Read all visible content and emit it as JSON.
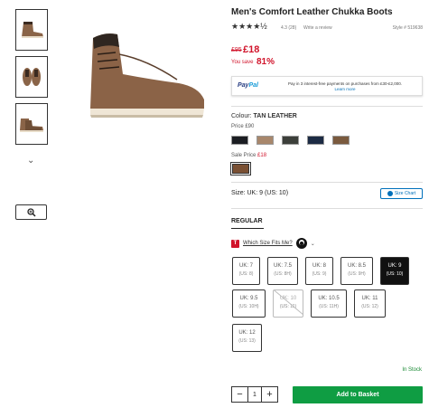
{
  "product": {
    "title": "Men's Comfort Leather Chukka Boots",
    "stars": "★★★★½",
    "rating": "4.3 (28)",
    "write_review": "Write a review",
    "style": "Style # 519638"
  },
  "price": {
    "was": "£95",
    "now": "£18",
    "save_label": "You save",
    "save_percent": "81%"
  },
  "paypal": {
    "logo_pay": "Pay",
    "logo_pal": "Pal",
    "text": "Pay in 3 interest-free payments on purchases from £30-£2,000.",
    "learn_more": "Learn more"
  },
  "colour": {
    "label": "Colour: ",
    "value": "TAN LEATHER",
    "price_label": "Price £90",
    "swatches": [
      "#1b1d22",
      "#a8876c",
      "#3c3f3a",
      "#1c2b44",
      "#7a5a3e"
    ],
    "sale_label": "Sale Price ",
    "sale_price": "£18",
    "sale_swatch": "#7a5033"
  },
  "size": {
    "label": "Size: UK: 9 (US: 10)",
    "chart_button": "Size Chart",
    "fit_tab": "REGULAR",
    "fit_link": "Which Size Fits Me?",
    "options": [
      {
        "uk": "UK: 7",
        "us": "(US: 8)"
      },
      {
        "uk": "UK: 7.5",
        "us": "(US: 8H)"
      },
      {
        "uk": "UK: 8",
        "us": "(US: 9)"
      },
      {
        "uk": "UK: 8.5",
        "us": "(US: 9H)"
      },
      {
        "uk": "UK: 9",
        "us": "(US: 10)"
      },
      {
        "uk": "UK: 9.5",
        "us": "(US: 10H)"
      },
      {
        "uk": "UK: 10",
        "us": "(US: 11)"
      },
      {
        "uk": "UK: 10.5",
        "us": "(US: 11H)"
      },
      {
        "uk": "UK: 11",
        "us": "(US: 12)"
      },
      {
        "uk": "UK: 12",
        "us": "(US: 13)"
      }
    ]
  },
  "stock": "In Stock",
  "cart": {
    "minus": "−",
    "qty": "1",
    "plus": "+",
    "add_label": "Add to Basket"
  },
  "colors": {
    "accent_red": "#d1142b",
    "add_green": "#0f9d43",
    "paypal_blue": "#0070ba"
  }
}
